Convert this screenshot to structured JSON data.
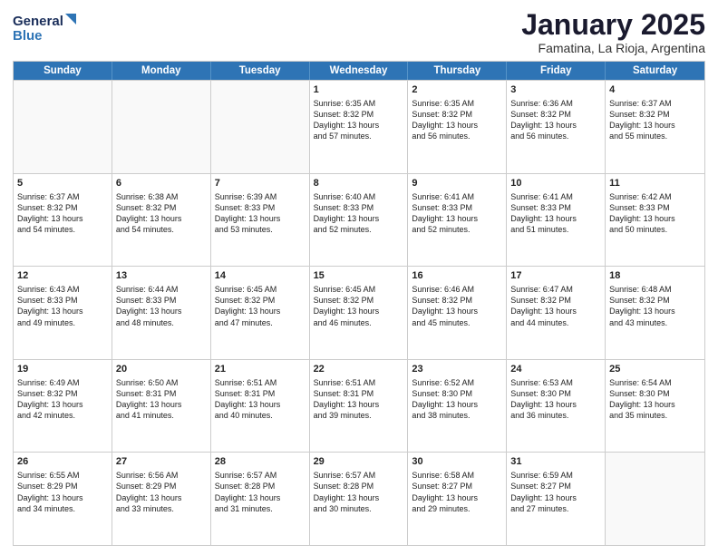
{
  "logo": {
    "line1": "General",
    "line2": "Blue"
  },
  "title": "January 2025",
  "subtitle": "Famatina, La Rioja, Argentina",
  "header_days": [
    "Sunday",
    "Monday",
    "Tuesday",
    "Wednesday",
    "Thursday",
    "Friday",
    "Saturday"
  ],
  "weeks": [
    [
      {
        "day": "",
        "text": ""
      },
      {
        "day": "",
        "text": ""
      },
      {
        "day": "",
        "text": ""
      },
      {
        "day": "1",
        "text": "Sunrise: 6:35 AM\nSunset: 8:32 PM\nDaylight: 13 hours\nand 57 minutes."
      },
      {
        "day": "2",
        "text": "Sunrise: 6:35 AM\nSunset: 8:32 PM\nDaylight: 13 hours\nand 56 minutes."
      },
      {
        "day": "3",
        "text": "Sunrise: 6:36 AM\nSunset: 8:32 PM\nDaylight: 13 hours\nand 56 minutes."
      },
      {
        "day": "4",
        "text": "Sunrise: 6:37 AM\nSunset: 8:32 PM\nDaylight: 13 hours\nand 55 minutes."
      }
    ],
    [
      {
        "day": "5",
        "text": "Sunrise: 6:37 AM\nSunset: 8:32 PM\nDaylight: 13 hours\nand 54 minutes."
      },
      {
        "day": "6",
        "text": "Sunrise: 6:38 AM\nSunset: 8:32 PM\nDaylight: 13 hours\nand 54 minutes."
      },
      {
        "day": "7",
        "text": "Sunrise: 6:39 AM\nSunset: 8:33 PM\nDaylight: 13 hours\nand 53 minutes."
      },
      {
        "day": "8",
        "text": "Sunrise: 6:40 AM\nSunset: 8:33 PM\nDaylight: 13 hours\nand 52 minutes."
      },
      {
        "day": "9",
        "text": "Sunrise: 6:41 AM\nSunset: 8:33 PM\nDaylight: 13 hours\nand 52 minutes."
      },
      {
        "day": "10",
        "text": "Sunrise: 6:41 AM\nSunset: 8:33 PM\nDaylight: 13 hours\nand 51 minutes."
      },
      {
        "day": "11",
        "text": "Sunrise: 6:42 AM\nSunset: 8:33 PM\nDaylight: 13 hours\nand 50 minutes."
      }
    ],
    [
      {
        "day": "12",
        "text": "Sunrise: 6:43 AM\nSunset: 8:33 PM\nDaylight: 13 hours\nand 49 minutes."
      },
      {
        "day": "13",
        "text": "Sunrise: 6:44 AM\nSunset: 8:33 PM\nDaylight: 13 hours\nand 48 minutes."
      },
      {
        "day": "14",
        "text": "Sunrise: 6:45 AM\nSunset: 8:32 PM\nDaylight: 13 hours\nand 47 minutes."
      },
      {
        "day": "15",
        "text": "Sunrise: 6:45 AM\nSunset: 8:32 PM\nDaylight: 13 hours\nand 46 minutes."
      },
      {
        "day": "16",
        "text": "Sunrise: 6:46 AM\nSunset: 8:32 PM\nDaylight: 13 hours\nand 45 minutes."
      },
      {
        "day": "17",
        "text": "Sunrise: 6:47 AM\nSunset: 8:32 PM\nDaylight: 13 hours\nand 44 minutes."
      },
      {
        "day": "18",
        "text": "Sunrise: 6:48 AM\nSunset: 8:32 PM\nDaylight: 13 hours\nand 43 minutes."
      }
    ],
    [
      {
        "day": "19",
        "text": "Sunrise: 6:49 AM\nSunset: 8:32 PM\nDaylight: 13 hours\nand 42 minutes."
      },
      {
        "day": "20",
        "text": "Sunrise: 6:50 AM\nSunset: 8:31 PM\nDaylight: 13 hours\nand 41 minutes."
      },
      {
        "day": "21",
        "text": "Sunrise: 6:51 AM\nSunset: 8:31 PM\nDaylight: 13 hours\nand 40 minutes."
      },
      {
        "day": "22",
        "text": "Sunrise: 6:51 AM\nSunset: 8:31 PM\nDaylight: 13 hours\nand 39 minutes."
      },
      {
        "day": "23",
        "text": "Sunrise: 6:52 AM\nSunset: 8:30 PM\nDaylight: 13 hours\nand 38 minutes."
      },
      {
        "day": "24",
        "text": "Sunrise: 6:53 AM\nSunset: 8:30 PM\nDaylight: 13 hours\nand 36 minutes."
      },
      {
        "day": "25",
        "text": "Sunrise: 6:54 AM\nSunset: 8:30 PM\nDaylight: 13 hours\nand 35 minutes."
      }
    ],
    [
      {
        "day": "26",
        "text": "Sunrise: 6:55 AM\nSunset: 8:29 PM\nDaylight: 13 hours\nand 34 minutes."
      },
      {
        "day": "27",
        "text": "Sunrise: 6:56 AM\nSunset: 8:29 PM\nDaylight: 13 hours\nand 33 minutes."
      },
      {
        "day": "28",
        "text": "Sunrise: 6:57 AM\nSunset: 8:28 PM\nDaylight: 13 hours\nand 31 minutes."
      },
      {
        "day": "29",
        "text": "Sunrise: 6:57 AM\nSunset: 8:28 PM\nDaylight: 13 hours\nand 30 minutes."
      },
      {
        "day": "30",
        "text": "Sunrise: 6:58 AM\nSunset: 8:27 PM\nDaylight: 13 hours\nand 29 minutes."
      },
      {
        "day": "31",
        "text": "Sunrise: 6:59 AM\nSunset: 8:27 PM\nDaylight: 13 hours\nand 27 minutes."
      },
      {
        "day": "",
        "text": ""
      }
    ]
  ]
}
